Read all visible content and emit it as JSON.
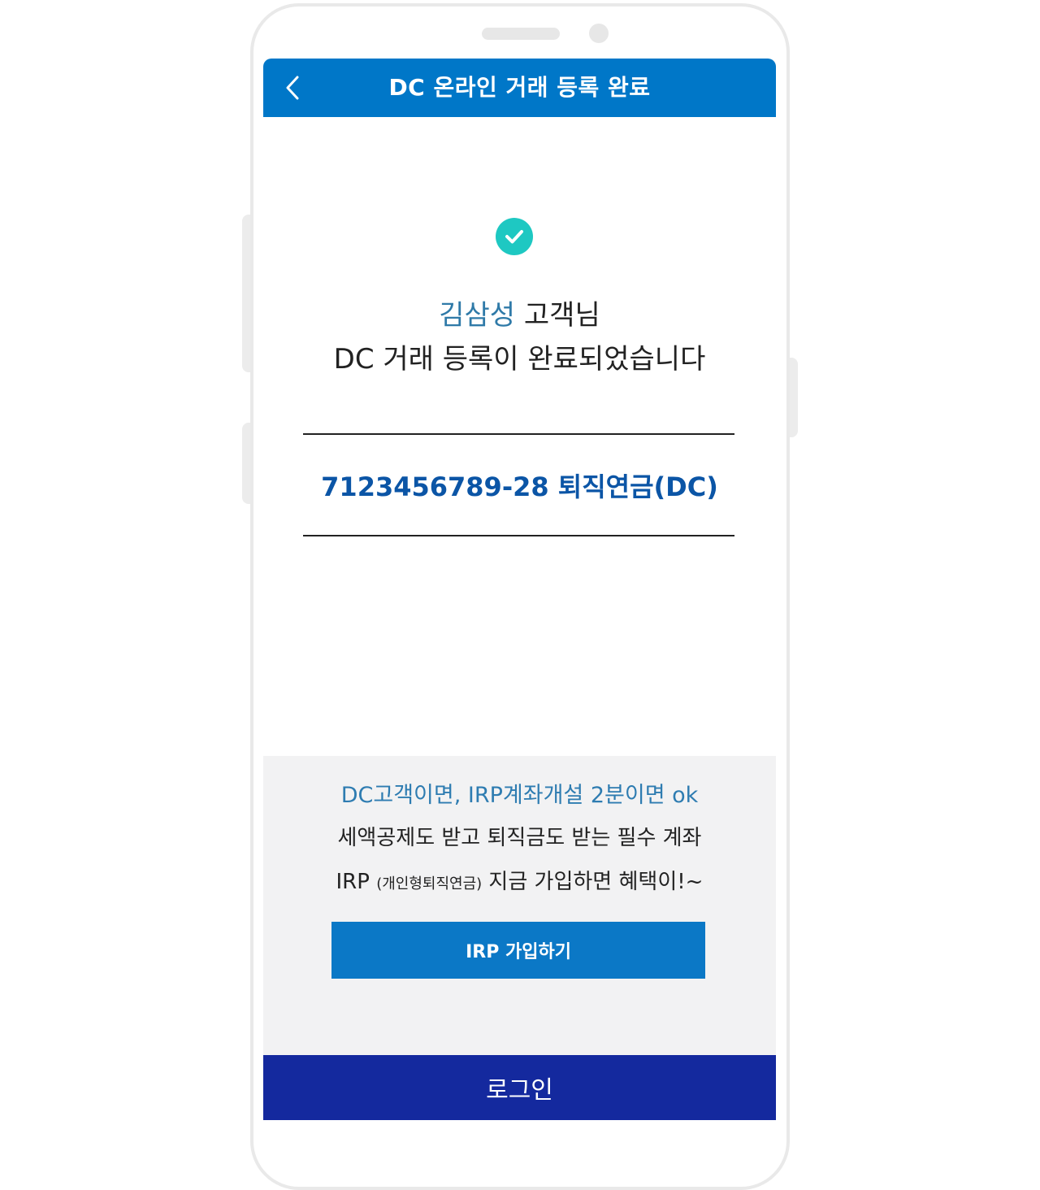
{
  "header": {
    "title": "DC 온라인 거래 등록 완료",
    "back_icon": "chevron-left-icon"
  },
  "status": {
    "icon": "check-circle-icon",
    "accent_color": "#1ec8c2"
  },
  "message": {
    "customer_name": "김삼성",
    "honorific": " 고객님",
    "completion": "DC 거래 등록이 완료되었습니다"
  },
  "account": {
    "label": "7123456789-28 퇴직연금(DC)"
  },
  "promo": {
    "heading": "DC고객이면, IRP계좌개설 2분이면 ok",
    "line1": "세액공제도 받고 퇴직금도 받는 필수 계좌",
    "line2_prefix": "IRP",
    "line2_note": "(개인형퇴직연금)",
    "line2_suffix": " 지금 가입하면 혜택이!~",
    "button_label": "IRP 가입하기"
  },
  "footer": {
    "login_label": "로그인"
  },
  "colors": {
    "header_bg": "#0077c8",
    "login_bg": "#14299e",
    "account_text": "#0b55a6",
    "name_text": "#2f7aa8"
  }
}
